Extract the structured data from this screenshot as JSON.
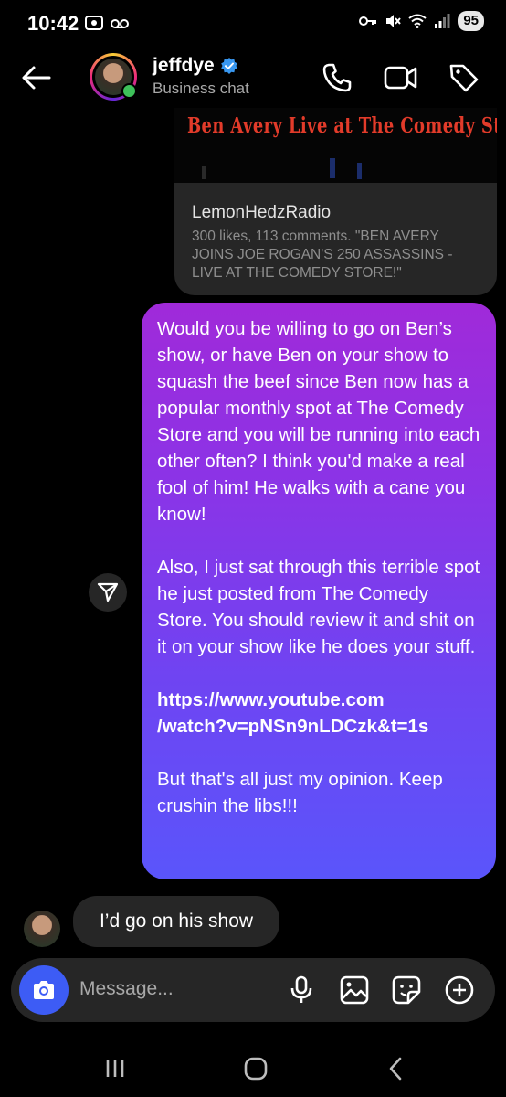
{
  "status_bar": {
    "time": "10:42",
    "battery": "95",
    "icons": [
      "screen-record-icon",
      "voicemail-icon",
      "key-icon",
      "mute-icon",
      "wifi-icon",
      "signal-icon"
    ]
  },
  "header": {
    "username": "jeffdye",
    "subtitle": "Business chat",
    "verified": true,
    "icons": [
      "back-arrow-icon",
      "phone-icon",
      "video-camera-icon",
      "tag-icon"
    ]
  },
  "link_card": {
    "thumbnail_title": "Ben Avery Live at The Comedy Store",
    "source": "LemonHedzRadio",
    "description": "300 likes, 113 comments. \"BEN AVERY JOINS JOE ROGAN'S 250 ASSASSINS - LIVE AT THE COMEDY STORE!\""
  },
  "outgoing_message": {
    "paragraph1": "Would you be willing to go on Ben’s show, or have Ben on your show to squash the beef since Ben now has a popular monthly spot at The Comedy Store and you will be running into each other often? I think you'd make a real fool of him! He walks with a cane you know!",
    "paragraph2": "Also, I just sat through this terrible spot he just posted from The Comedy Store. You should review it and shit on it on your show like he does your stuff.",
    "link_line1": "https://www.youtube.com",
    "link_line2": "/watch?v=pNSn9nLDCzk&t=1s",
    "paragraph3": "But that's all just my opinion. Keep crushin the libs!!!",
    "colors": {
      "gradient_top": "#a02ad9",
      "gradient_bottom": "#5a55fb"
    }
  },
  "incoming_message": {
    "text": "I’d go on his show"
  },
  "composer": {
    "placeholder": "Message...",
    "icons": [
      "camera-icon",
      "microphone-icon",
      "image-icon",
      "sticker-icon",
      "plus-circle-icon"
    ],
    "camera_color": "#3d5cf5"
  },
  "nav_bar": {
    "icons": [
      "recent-apps-icon",
      "home-icon",
      "back-icon"
    ]
  }
}
